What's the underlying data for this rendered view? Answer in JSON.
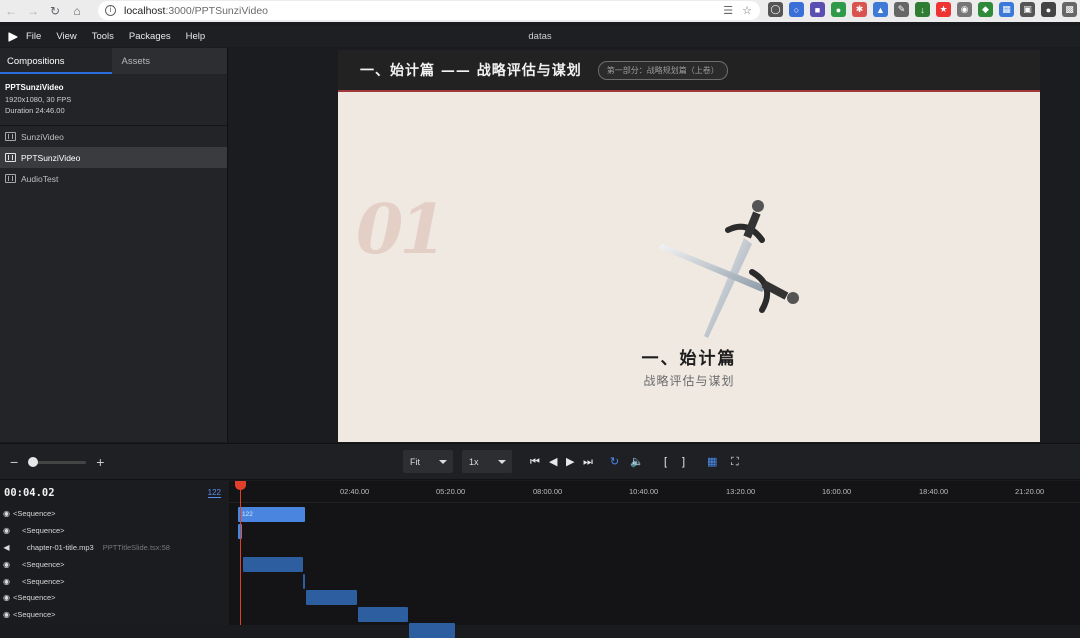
{
  "browser": {
    "url_host": "localhost",
    "url_path": ":3000/PPTSunziVideo"
  },
  "menu": {
    "items": [
      "File",
      "View",
      "Tools",
      "Packages",
      "Help"
    ],
    "app_title": "datas"
  },
  "sidebar": {
    "tabs": [
      "Compositions",
      "Assets"
    ],
    "info": {
      "name": "PPTSunziVideo",
      "resolution": "1920x1080, 30 FPS",
      "duration": "Duration 24:46.00"
    },
    "compositions": [
      "SunziVideo",
      "PPTSunziVideo",
      "AudioTest"
    ]
  },
  "slide": {
    "title": "一、始计篇 —— 战略评估与谋划",
    "badge": "第一部分：战略规划篇（上卷）",
    "number": "01",
    "heading": "一、始计篇",
    "subheading": "战略评估与谋划"
  },
  "controls": {
    "zoom_level": 0.0,
    "fit_label": "Fit",
    "rate_label": "1x"
  },
  "timeline": {
    "timecode": "00:04.02",
    "frame": "122",
    "ruler": [
      "02:40.00",
      "05:20.00",
      "08:00.00",
      "10:40.00",
      "13:20.00",
      "16:00.00",
      "18:40.00",
      "21:20.00"
    ],
    "tracks": [
      {
        "label": "<Sequence>",
        "meta": ""
      },
      {
        "label": "<Sequence>",
        "meta": ""
      },
      {
        "label": "chapter-01-title.mp3",
        "meta": "PPTTitleSlide.tsx:58"
      },
      {
        "label": "<Sequence>",
        "meta": ""
      },
      {
        "label": "<Sequence>",
        "meta": ""
      },
      {
        "label": "<Sequence>",
        "meta": ""
      },
      {
        "label": "<Sequence>",
        "meta": ""
      }
    ],
    "first_clip_label": "122"
  },
  "colors": {
    "accent": "#2d6cdf",
    "playhead": "#e0402a",
    "clip": "#2c5ea0",
    "slide_rule": "#a03a3a"
  }
}
